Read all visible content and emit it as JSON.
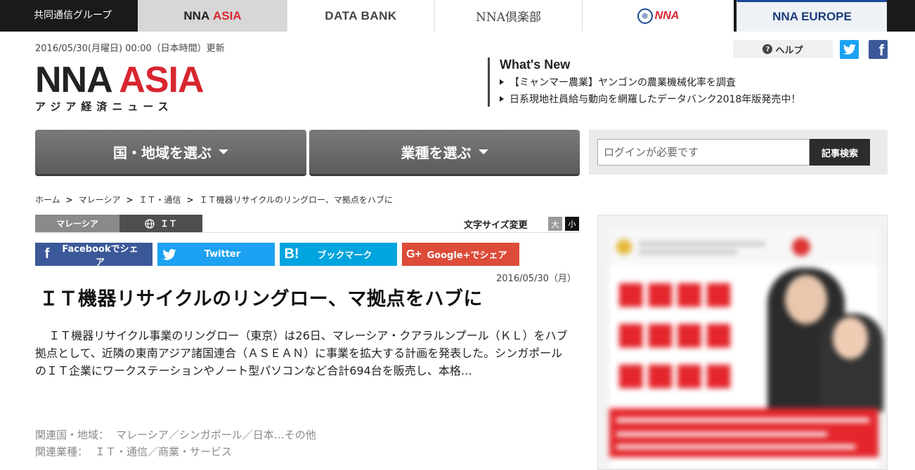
{
  "topbar": {
    "group_label": "共同通信グループ",
    "tabs": {
      "asia_nna": "NNA",
      "asia_word": "ASIA",
      "databank": "DATA BANK",
      "club": "NNA倶楽部",
      "logo_text": "NNA",
      "europe": "NNA EUROPE"
    }
  },
  "header": {
    "updated": "2016/05/30(月曜日) 00:00（日本時間）更新",
    "logo_nna": "NNA",
    "logo_asia": "ASIA",
    "logo_sub": "アジア経済ニュース",
    "help_label": "ヘルプ",
    "twitter_icon": "twitter-icon",
    "facebook_icon": "facebook-icon"
  },
  "whats_new": {
    "title": "What's New",
    "items": [
      "【ミャンマー農業】ヤンゴンの農業機械化率を調査",
      "日系現地社員給与動向を網羅したデータバンク2018年版発売中！"
    ]
  },
  "nav": {
    "country": "国・地域を選ぶ",
    "industry": "業種を選ぶ"
  },
  "search": {
    "placeholder": "ログインが必要です",
    "button": "記事検索"
  },
  "breadcrumb": [
    "ホーム",
    "マレーシア",
    "ＩＴ・通信",
    "ＩＴ機器リサイクルのリングロー、マ拠点をハブに"
  ],
  "categories": {
    "country": "マレーシア",
    "industry": "ＩＴ"
  },
  "font_size": {
    "label": "文字サイズ変更",
    "large": "大",
    "small": "小"
  },
  "share": {
    "facebook": "Facebookでシェア",
    "twitter": "Twitter",
    "hatena": "ブックマーク",
    "google": "Google+でシェア"
  },
  "article": {
    "date": "2016/05/30（月）",
    "headline": "ＩＴ機器リサイクルのリングロー、マ拠点をハブに",
    "lead": "ＩＴ機器リサイクル事業のリングロー（東京）は26日、マレーシア・クアラルンプール（ＫＬ）をハブ拠点として、近隣の東南アジア諸国連合（ＡＳＥＡＮ）に事業を拡大する計画を発表した。シンガポールのＩＴ企業にワークステーションやノート型パソコンなど合計694台を販売し、本格…",
    "related_regions_label": "関連国・地域：",
    "related_regions": "マレーシア／シンガポール／日本…その他",
    "related_industries_label": "関連業種：",
    "related_industries": "ＩＴ・通信／商業・サービス"
  },
  "colors": {
    "brand_red": "#d8262f",
    "facebook": "#3b5998",
    "twitter": "#1da1f2",
    "hatena": "#00a4de",
    "google": "#dd4b39"
  }
}
